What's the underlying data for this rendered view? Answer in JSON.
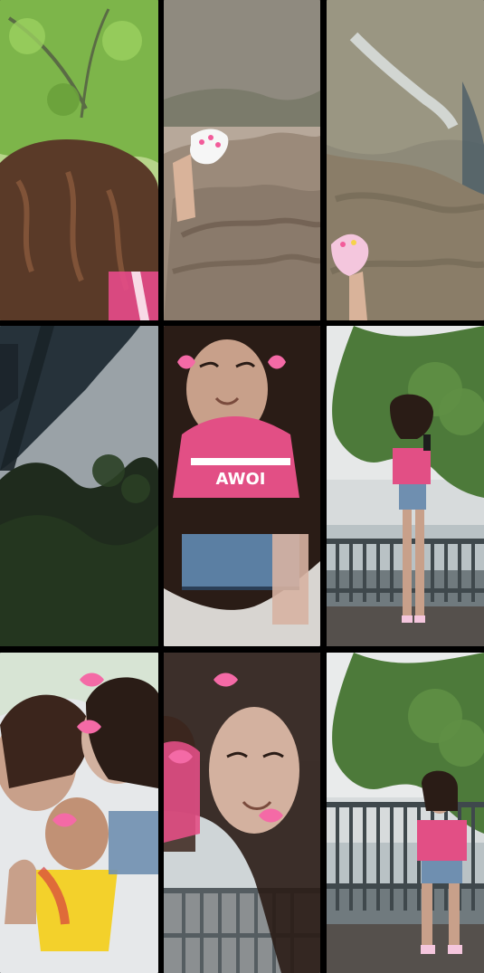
{
  "grid": {
    "rows": 3,
    "columns": 3,
    "tiles": [
      {
        "scene": "tree-canopy-hair-selfie"
      },
      {
        "scene": "foot-on-rocks-water"
      },
      {
        "scene": "rocks-stream-foot"
      },
      {
        "scene": "gazebo-roof-sky-trees"
      },
      {
        "scene": "close-up-selfie-pink-jersey"
      },
      {
        "scene": "girl-on-deck-by-railing-taking-photo"
      },
      {
        "scene": "group-selfie-heart-stickers"
      },
      {
        "scene": "close-face-heart-stickers"
      },
      {
        "scene": "girl-sitting-on-railing"
      }
    ],
    "printed_text": {
      "jersey_front": "AWOI"
    }
  }
}
